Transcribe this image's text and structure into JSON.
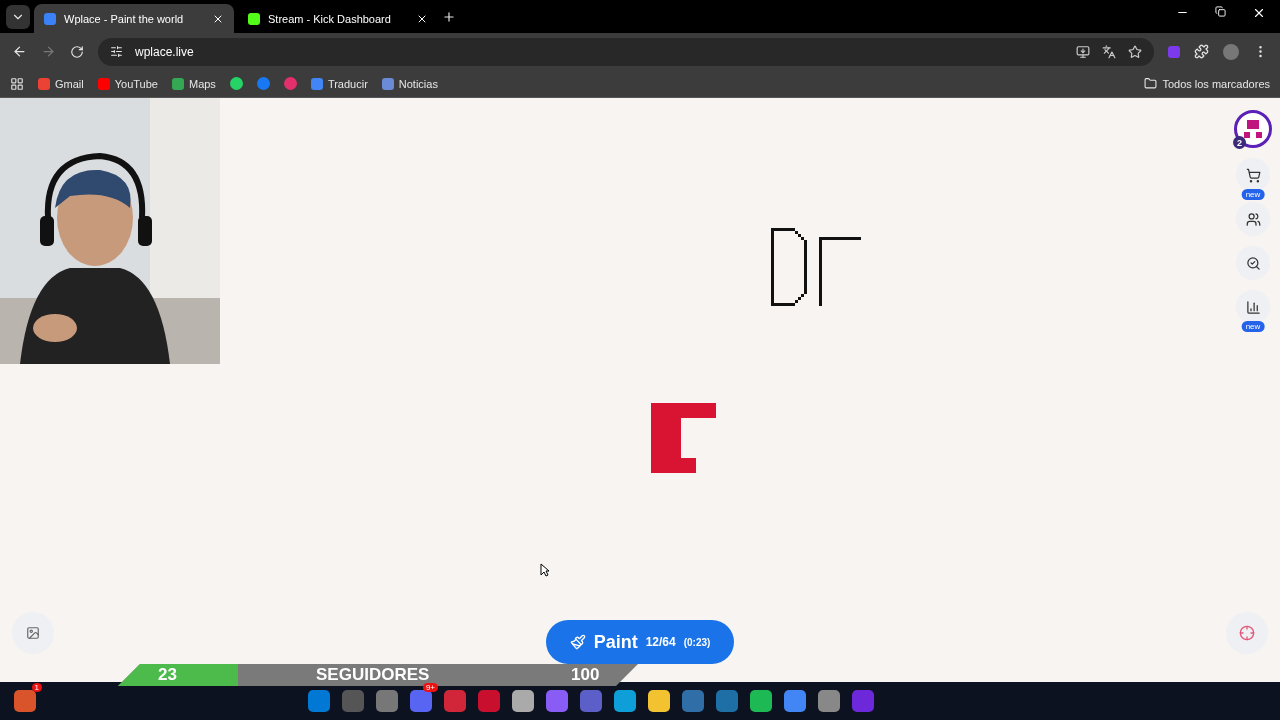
{
  "tabs": [
    {
      "title": "Wplace - Paint the world",
      "selected": true,
      "color": "#3b82f6"
    },
    {
      "title": "Stream - Kick Dashboard",
      "selected": false,
      "color": "#53fc18"
    }
  ],
  "address": {
    "url": "wplace.live"
  },
  "bookmarks": [
    {
      "kind": "link",
      "label": "Gmail",
      "color": "#ea4335"
    },
    {
      "kind": "link",
      "label": "YouTube",
      "color": "#ff0000"
    },
    {
      "kind": "link",
      "label": "Maps",
      "color": "#34a853"
    },
    {
      "kind": "icon",
      "color": "#25d366"
    },
    {
      "kind": "icon",
      "color": "#1877f2"
    },
    {
      "kind": "icon",
      "color": "#e1306c"
    },
    {
      "kind": "link",
      "label": "Traducir",
      "color": "#4285f4"
    },
    {
      "kind": "link",
      "label": "Noticias",
      "color": "#6b8bd6"
    }
  ],
  "all_bookmarks": "Todos los marcadores",
  "side_menu": {
    "level_badge": "2",
    "buttons": [
      {
        "kind": "cart",
        "badge": "new"
      },
      {
        "kind": "users"
      },
      {
        "kind": "search"
      },
      {
        "kind": "chart",
        "badge": "new"
      }
    ]
  },
  "paint_button": {
    "label": "Paint",
    "charges": "12/64",
    "timer": "(0:23)"
  },
  "followers": {
    "count": "23",
    "label": "SEGUIDORES",
    "goal": "100",
    "level": 0.23
  },
  "taskbar": {
    "apps": [
      {
        "color": "#d9532b",
        "badge": "1"
      },
      {
        "color": "#0078d4"
      },
      {
        "color": "#555555"
      },
      {
        "color": "#777777"
      },
      {
        "color": "#5865f2",
        "badge": "9+"
      },
      {
        "color": "#d1263a"
      },
      {
        "color": "#c8102e"
      },
      {
        "color": "#aaaaaa"
      },
      {
        "color": "#8a5cf6"
      },
      {
        "color": "#5b5fc7"
      },
      {
        "color": "#0f9fd8"
      },
      {
        "color": "#f2c230"
      },
      {
        "color": "#2f6ea6"
      },
      {
        "color": "#1d6fa5"
      },
      {
        "color": "#1db954"
      },
      {
        "color": "#4285f4"
      },
      {
        "color": "#888888"
      },
      {
        "color": "#6d28d9"
      }
    ]
  }
}
